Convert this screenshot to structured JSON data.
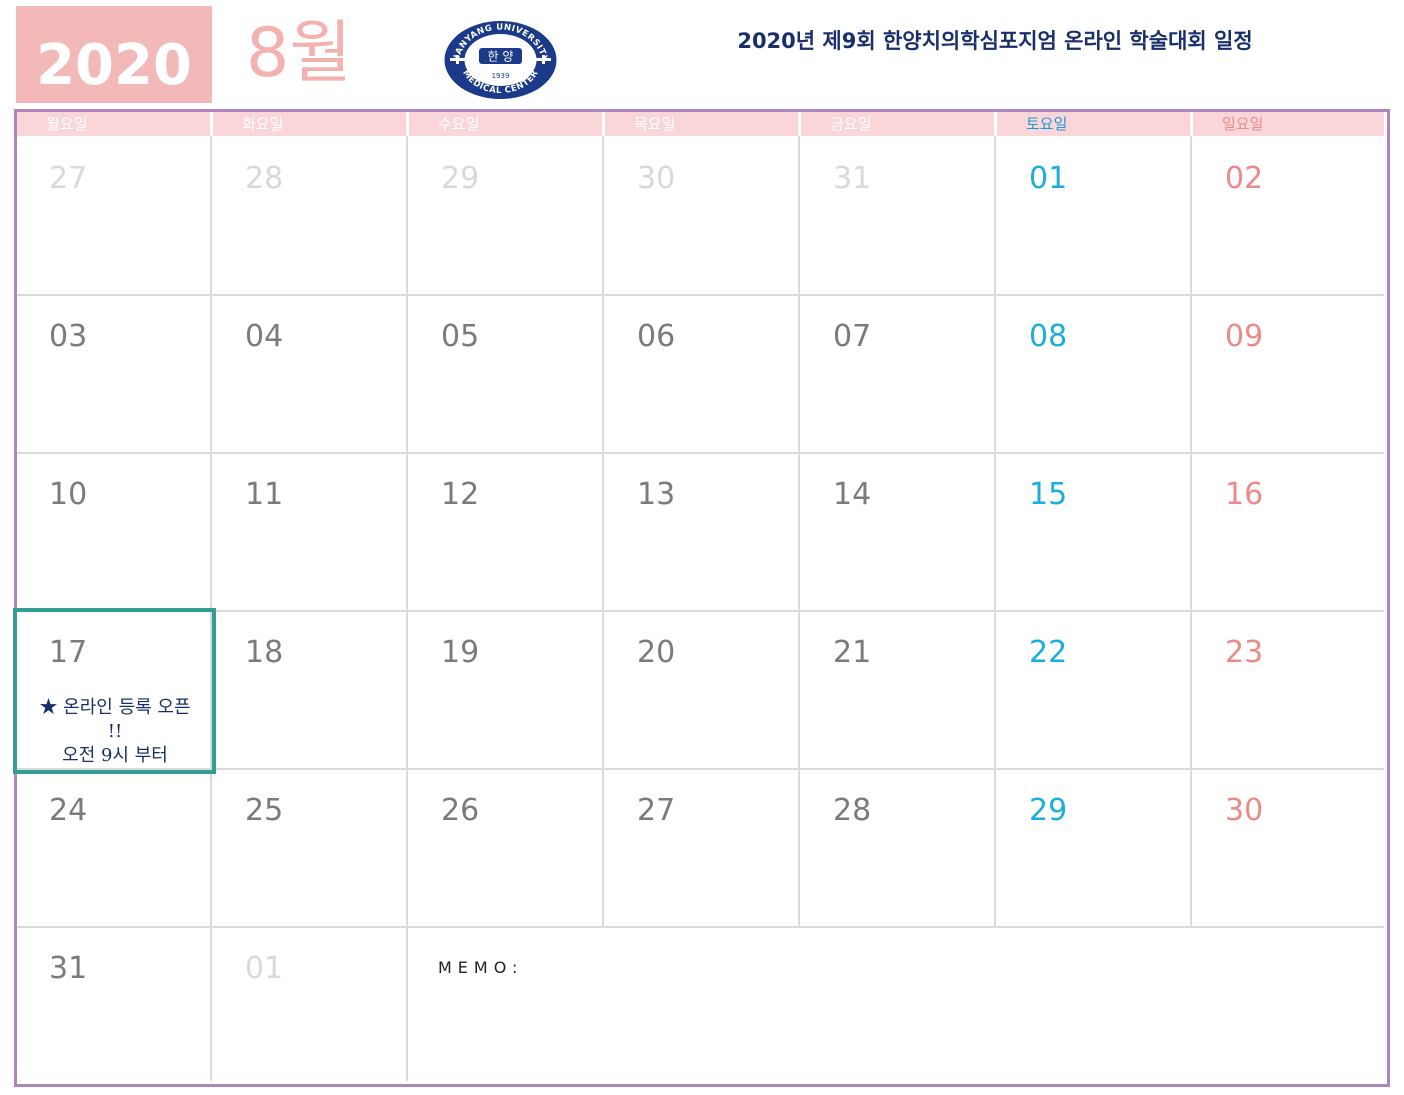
{
  "header": {
    "year": "2020",
    "month": "8월",
    "title": "2020년 제9회 한양치의학심포지엄 온라인 학술대회 일정",
    "logo": {
      "arc_top": "HANYANG UNIVERSITY",
      "arc_bottom": "MEDICAL CENTER",
      "center": "한 양",
      "year": "1939"
    }
  },
  "weekdays": [
    "월요일",
    "화요일",
    "수요일",
    "목요일",
    "금요일",
    "토요일",
    "일요일"
  ],
  "weeks": [
    [
      {
        "d": "27",
        "t": "out"
      },
      {
        "d": "28",
        "t": "out"
      },
      {
        "d": "29",
        "t": "out"
      },
      {
        "d": "30",
        "t": "out"
      },
      {
        "d": "31",
        "t": "out"
      },
      {
        "d": "01",
        "t": "sat"
      },
      {
        "d": "02",
        "t": "sun"
      }
    ],
    [
      {
        "d": "03",
        "t": "day"
      },
      {
        "d": "04",
        "t": "day"
      },
      {
        "d": "05",
        "t": "day"
      },
      {
        "d": "06",
        "t": "day"
      },
      {
        "d": "07",
        "t": "day"
      },
      {
        "d": "08",
        "t": "sat"
      },
      {
        "d": "09",
        "t": "sun"
      }
    ],
    [
      {
        "d": "10",
        "t": "day"
      },
      {
        "d": "11",
        "t": "day"
      },
      {
        "d": "12",
        "t": "day"
      },
      {
        "d": "13",
        "t": "day"
      },
      {
        "d": "14",
        "t": "day"
      },
      {
        "d": "15",
        "t": "sat"
      },
      {
        "d": "16",
        "t": "sun"
      }
    ],
    [
      {
        "d": "17",
        "t": "day"
      },
      {
        "d": "18",
        "t": "day"
      },
      {
        "d": "19",
        "t": "day"
      },
      {
        "d": "20",
        "t": "day"
      },
      {
        "d": "21",
        "t": "day"
      },
      {
        "d": "22",
        "t": "sat"
      },
      {
        "d": "23",
        "t": "sun"
      }
    ],
    [
      {
        "d": "24",
        "t": "day"
      },
      {
        "d": "25",
        "t": "day"
      },
      {
        "d": "26",
        "t": "day"
      },
      {
        "d": "27",
        "t": "day"
      },
      {
        "d": "28",
        "t": "day"
      },
      {
        "d": "29",
        "t": "sat"
      },
      {
        "d": "30",
        "t": "sun"
      }
    ],
    [
      {
        "d": "31",
        "t": "day"
      },
      {
        "d": "01",
        "t": "out"
      }
    ]
  ],
  "event": {
    "lines": [
      "★ 온라인 등록 오픈",
      "!!",
      "오전 9시 부터"
    ]
  },
  "memo_label": "MEMO:",
  "colors": {
    "year_bg": "#f3b8b8",
    "month": "#f3b2b0",
    "title": "#1a2f6a",
    "frame": "#ae85bc",
    "weekday_bg": "#fbd6d9",
    "saturday": "#1aaedf",
    "sunday": "#ec8a8a",
    "weekday": "#7b7b7b",
    "out_of_month": "#d9d9d9",
    "highlight": "#349e92"
  }
}
